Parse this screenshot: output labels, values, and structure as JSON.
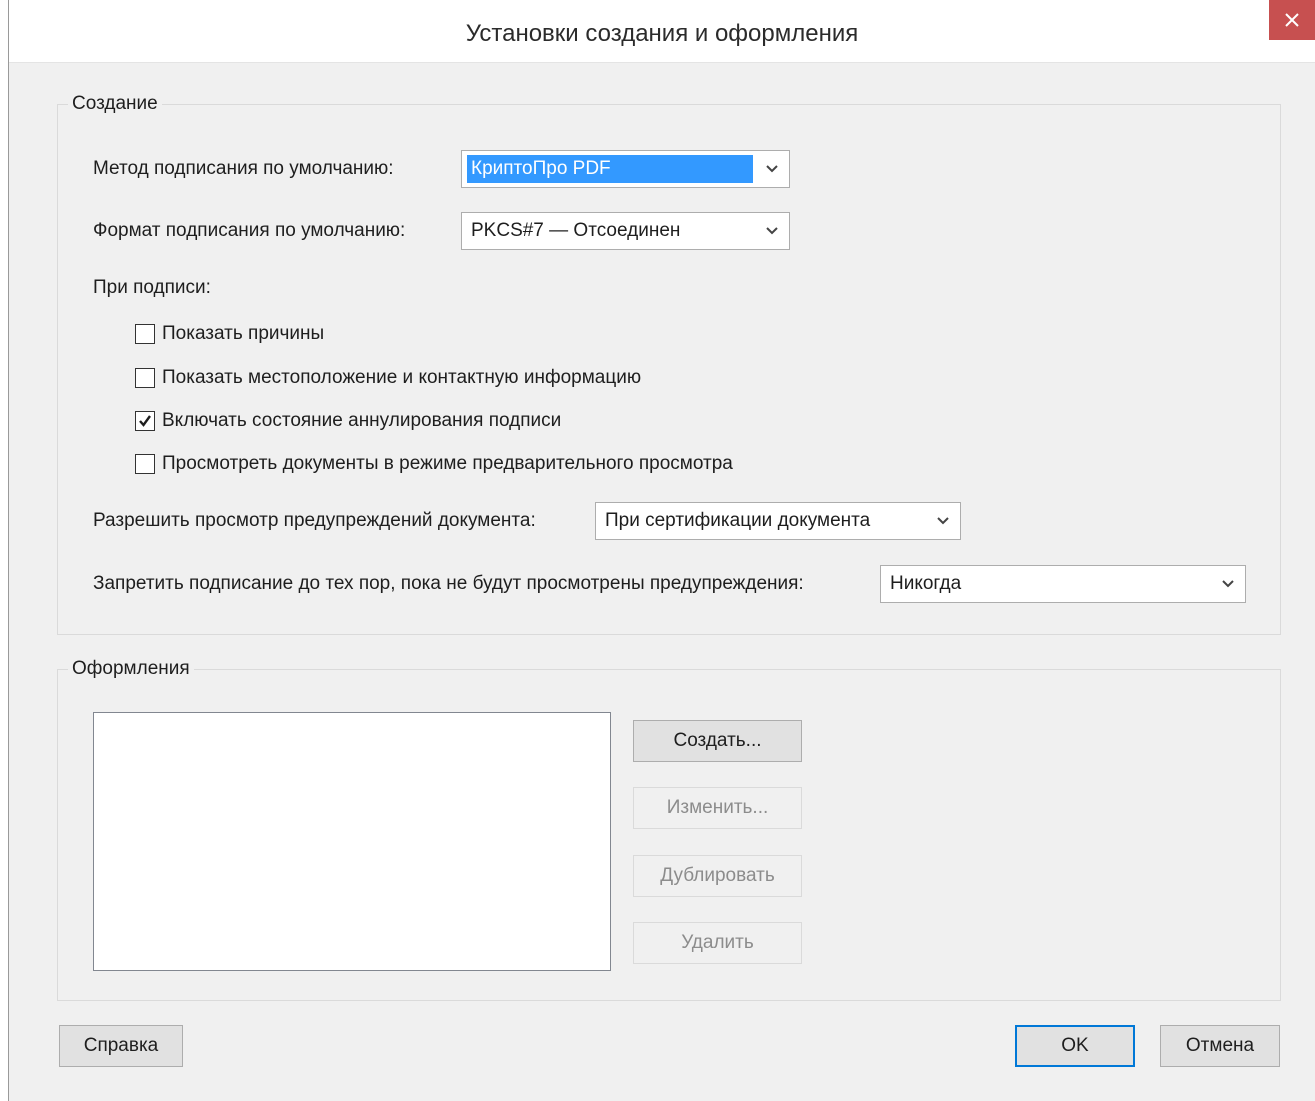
{
  "window": {
    "title": "Установки создания и оформления",
    "close_glyph": "✕"
  },
  "creation": {
    "group_label": "Создание",
    "signing_method": {
      "label": "Метод подписания по умолчанию:",
      "value": "КриптоПро PDF"
    },
    "signing_format": {
      "label": "Формат подписания по умолчанию:",
      "value": "PKCS#7 — Отсоединен"
    },
    "on_sign_label": "При подписи:",
    "checkboxes": [
      {
        "label": "Показать причины",
        "checked": false
      },
      {
        "label": "Показать местоположение и контактную информацию",
        "checked": false
      },
      {
        "label": "Включать состояние аннулирования подписи",
        "checked": true
      },
      {
        "label": "Просмотреть документы в режиме предварительного просмотра",
        "checked": false
      }
    ],
    "allow_warnings": {
      "label": "Разрешить просмотр предупреждений документа:",
      "value": "При сертификации документа"
    },
    "prevent_signing": {
      "label": "Запретить подписание до тех пор, пока не будут просмотрены предупреждения:",
      "value": "Никогда"
    }
  },
  "appearances": {
    "group_label": "Оформления",
    "buttons": {
      "create": "Создать...",
      "edit": "Изменить...",
      "duplicate": "Дублировать",
      "delete": "Удалить"
    }
  },
  "footer": {
    "help": "Справка",
    "ok": "OK",
    "cancel": "Отмена"
  },
  "colors": {
    "selection": "#3399ff",
    "close_button": "#c75050",
    "default_button_border": "#0078d7"
  }
}
